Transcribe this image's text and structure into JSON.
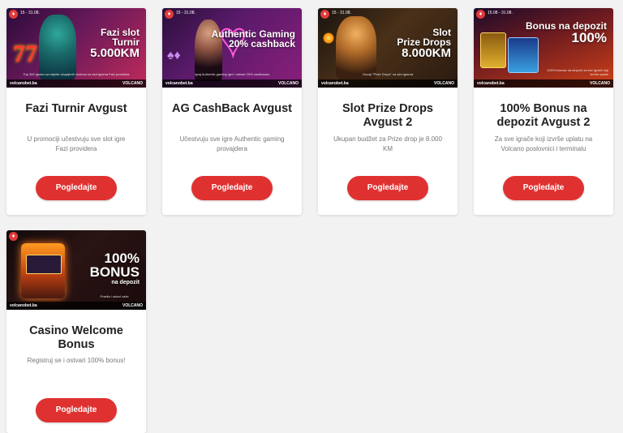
{
  "cards": [
    {
      "title": "Fazi Turnir Avgust",
      "description": "U promociji učestvuju sve slot igre Fazi providera",
      "button": "Pogledajte",
      "banner": {
        "line1": "Fazi slot",
        "line2": "Turnir",
        "line3": "5.000KM",
        "site": "volcanobet.ba",
        "brand": "VOLCANO",
        "date": "15 - 31.08.",
        "small": "Top 300 igrača sa najviše skupljenih bodova na slot igrama Fazi providera"
      }
    },
    {
      "title": "AG CashBack Avgust",
      "description": "Učestvuju sve igre Authentic gaming provajdera",
      "button": "Pogledajte",
      "banner": {
        "line1": "Authentic Gaming",
        "line2": "20% cashback",
        "line3": "",
        "site": "volcanobet.ba",
        "brand": "VOLCANO",
        "date": "15 - 31.08.",
        "small": "Igraj Authentic gaming igre i ostvari 20% cashbacka"
      }
    },
    {
      "title": "Slot Prize Drops Avgust 2",
      "description": "Ukupan budžet za Prize drop je 8.000 KM",
      "button": "Pogledajte",
      "banner": {
        "line1": "Slot",
        "line2": "Prize Drops",
        "line3": "8.000KM",
        "site": "volcanobet.ba",
        "brand": "VOLCANO",
        "date": "15 - 31.08.",
        "small": "Osvoji \"Prize Drops\" na slot igrama"
      }
    },
    {
      "title": "100% Bonus na depozit Avgust 2",
      "description": "Za sve igrače koji izvrše uplatu na Volcano poslovnici i terminalu",
      "button": "Pogledajte",
      "banner": {
        "line1": "Bonus na depozit",
        "line2": "100%",
        "line3": "",
        "site": "volcanobet.ba",
        "brand": "VOLCANO",
        "date": "15.08 - 31.08.",
        "small": "100% bonusa na depozit za sve igrače koji izvrše uplatu"
      }
    },
    {
      "title": "Casino Welcome Bonus",
      "description": "Registruj se i ostvari 100% bonus!",
      "button": "Pogledajte",
      "banner": {
        "line1": "100%",
        "line2": "BONUS",
        "line3": "na depozit",
        "site": "volcanobet.ba",
        "brand": "VOLCANO",
        "date": "",
        "small": "Pravila i uslovi važe"
      }
    }
  ]
}
